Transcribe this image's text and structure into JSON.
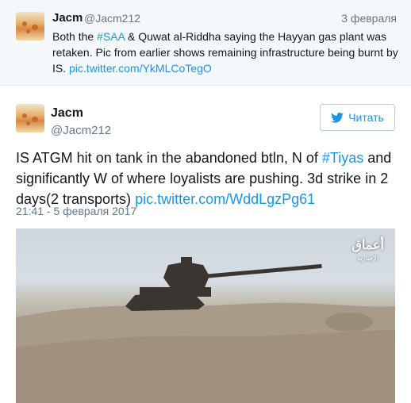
{
  "reply_tweet": {
    "author_name": "Jacm",
    "handle": "@Jacm212",
    "date": "3 февраля",
    "text_parts": [
      "Both the ",
      "#SAA",
      " & Quwat al-Riddha saying the Hayyan gas plant was retaken. Pic from earlier shows remaining infrastructure being burnt by IS. ",
      "pic.twitter.com/YkMLCoTegO"
    ]
  },
  "main_tweet": {
    "author_name": "Jacm",
    "handle": "@Jacm212",
    "follow_label": "Читать",
    "text_parts": [
      "IS ATGM hit on tank in the abandoned btln, N of ",
      "#Tiyas",
      " and significantly W of where loyalists are pushing. 3d strike in 2 days(2 transports) ",
      "pic.twitter.com/WddLgzPg61"
    ],
    "timestamp": "21:41 - 5 февраля 2017",
    "media": {
      "watermark": "أعماق",
      "watermark_sub": "الإخبارية"
    }
  },
  "colors": {
    "link": "#1b95e0",
    "muted": "#657786",
    "reply_bg": "#f5f8fa"
  },
  "icons": [
    "twitter-bird-icon"
  ]
}
